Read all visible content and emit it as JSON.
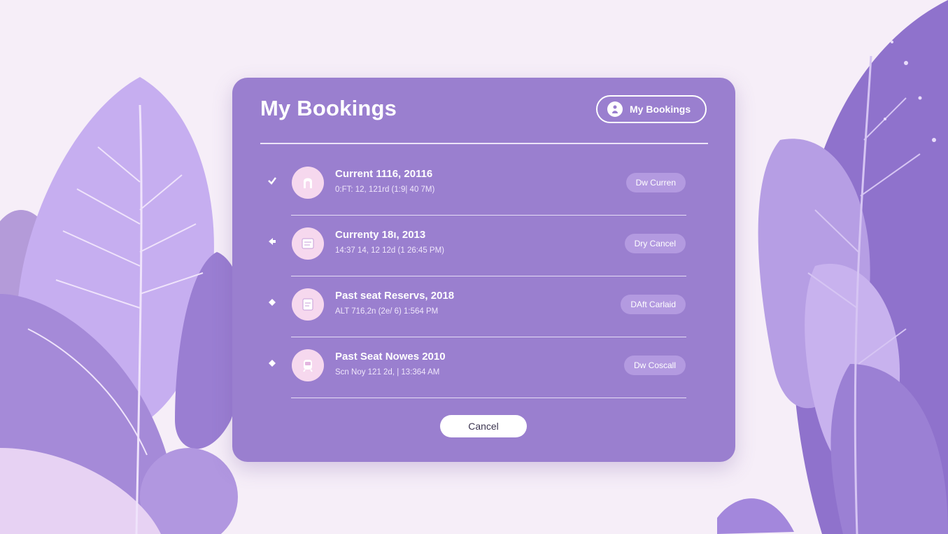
{
  "dialog": {
    "title": "My Bookings",
    "header_button_label": "My Bookings",
    "cancel_label": "Cancel"
  },
  "bookings": [
    {
      "title": "Current 1116, 20116",
      "subtitle": "0:FT: 12, 121rd (1:9| 40 7M)",
      "action": "Dw Curren",
      "marker": "check-icon",
      "avatar": "user-icon"
    },
    {
      "title": "Currenty 18ı, 2013",
      "subtitle": "14:37 14, 12 12d (1 26:45 PM)",
      "action": "Dry Cancel",
      "marker": "arrow-left-icon",
      "avatar": "document-icon"
    },
    {
      "title": "Past seat Reservs, 2018",
      "subtitle": "ALT 716,2n (2e/ 6) 1:564 PM",
      "action": "DAft Carlaid",
      "marker": "diamond-icon",
      "avatar": "document-icon"
    },
    {
      "title": "Past Seat Nowes 2010",
      "subtitle": "Scn Noy 121 2d, | 13:364 AM",
      "action": "Dw Coscall",
      "marker": "diamond-icon",
      "avatar": "train-icon"
    }
  ],
  "colors": {
    "panel": "#9a7fcf",
    "background": "#f6eef8",
    "action_pill": "#b39ae0",
    "avatar": "#f6d8ee"
  }
}
